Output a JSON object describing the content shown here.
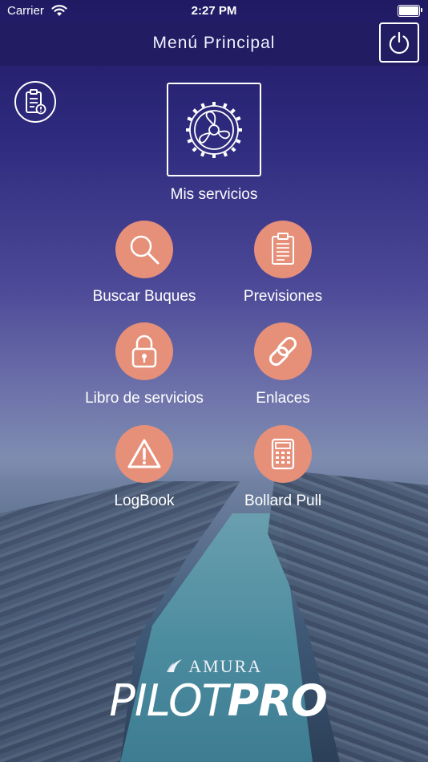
{
  "status_bar": {
    "carrier": "Carrier",
    "time": "2:27 PM"
  },
  "nav": {
    "title": "Menú Principal"
  },
  "main_service": {
    "label": "Mis servicios"
  },
  "menu_items": [
    {
      "label": "Buscar Buques",
      "icon": "search-icon"
    },
    {
      "label": "Previsiones",
      "icon": "clipboard-list-icon"
    },
    {
      "label": "Libro de servicios",
      "icon": "lock-icon"
    },
    {
      "label": "Enlaces",
      "icon": "link-icon"
    },
    {
      "label": "LogBook",
      "icon": "warning-icon"
    },
    {
      "label": "Bollard Pull",
      "icon": "calculator-icon"
    }
  ],
  "brand": {
    "company": "AMURA",
    "product_part1": "PILOT",
    "product_part2": "PRO"
  },
  "colors": {
    "nav_bar": "#221c62",
    "icon_circle": "#e6907a"
  }
}
